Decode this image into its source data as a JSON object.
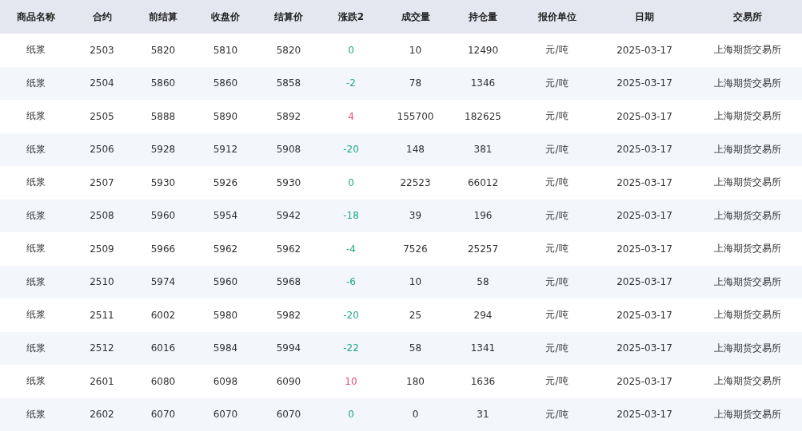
{
  "table": {
    "columns": [
      "商品名称",
      "合约",
      "前结算",
      "收盘价",
      "结算价",
      "涨跌2",
      "成交量",
      "持仓量",
      "报价单位",
      "日期",
      "交易所"
    ],
    "rows": [
      {
        "cells": [
          "纸浆",
          "2503",
          "5820",
          "5810",
          "5820"
        ],
        "change": {
          "text": "0",
          "color": "#1fa888"
        },
        "rest": [
          "10",
          "12490",
          "元/吨",
          "2025-03-17",
          "上海期货交易所"
        ]
      },
      {
        "cells": [
          "纸浆",
          "2504",
          "5860",
          "5860",
          "5858"
        ],
        "change": {
          "text": "-2",
          "color": "#1fa888"
        },
        "rest": [
          "78",
          "1346",
          "元/吨",
          "2025-03-17",
          "上海期货交易所"
        ]
      },
      {
        "cells": [
          "纸浆",
          "2505",
          "5888",
          "5890",
          "5892"
        ],
        "change": {
          "text": "4",
          "color": "#ee4d73"
        },
        "rest": [
          "155700",
          "182625",
          "元/吨",
          "2025-03-17",
          "上海期货交易所"
        ]
      },
      {
        "cells": [
          "纸浆",
          "2506",
          "5928",
          "5912",
          "5908"
        ],
        "change": {
          "text": "-20",
          "color": "#1fa888"
        },
        "rest": [
          "148",
          "381",
          "元/吨",
          "2025-03-17",
          "上海期货交易所"
        ]
      },
      {
        "cells": [
          "纸浆",
          "2507",
          "5930",
          "5926",
          "5930"
        ],
        "change": {
          "text": "0",
          "color": "#1fa888"
        },
        "rest": [
          "22523",
          "66012",
          "元/吨",
          "2025-03-17",
          "上海期货交易所"
        ]
      },
      {
        "cells": [
          "纸浆",
          "2508",
          "5960",
          "5954",
          "5942"
        ],
        "change": {
          "text": "-18",
          "color": "#1fa888"
        },
        "rest": [
          "39",
          "196",
          "元/吨",
          "2025-03-17",
          "上海期货交易所"
        ]
      },
      {
        "cells": [
          "纸浆",
          "2509",
          "5966",
          "5962",
          "5962"
        ],
        "change": {
          "text": "-4",
          "color": "#1fa888"
        },
        "rest": [
          "7526",
          "25257",
          "元/吨",
          "2025-03-17",
          "上海期货交易所"
        ]
      },
      {
        "cells": [
          "纸浆",
          "2510",
          "5974",
          "5960",
          "5968"
        ],
        "change": {
          "text": "-6",
          "color": "#1fa888"
        },
        "rest": [
          "10",
          "58",
          "元/吨",
          "2025-03-17",
          "上海期货交易所"
        ]
      },
      {
        "cells": [
          "纸浆",
          "2511",
          "6002",
          "5980",
          "5982"
        ],
        "change": {
          "text": "-20",
          "color": "#1fa888"
        },
        "rest": [
          "25",
          "294",
          "元/吨",
          "2025-03-17",
          "上海期货交易所"
        ]
      },
      {
        "cells": [
          "纸浆",
          "2512",
          "6016",
          "5984",
          "5994"
        ],
        "change": {
          "text": "-22",
          "color": "#1fa888"
        },
        "rest": [
          "58",
          "1341",
          "元/吨",
          "2025-03-17",
          "上海期货交易所"
        ]
      },
      {
        "cells": [
          "纸浆",
          "2601",
          "6080",
          "6098",
          "6090"
        ],
        "change": {
          "text": "10",
          "color": "#ee4d73"
        },
        "rest": [
          "180",
          "1636",
          "元/吨",
          "2025-03-17",
          "上海期货交易所"
        ]
      },
      {
        "cells": [
          "纸浆",
          "2602",
          "6070",
          "6070",
          "6070"
        ],
        "change": {
          "text": "0",
          "color": "#1fa888"
        },
        "rest": [
          "0",
          "31",
          "元/吨",
          "2025-03-17",
          "上海期货交易所"
        ]
      }
    ]
  }
}
